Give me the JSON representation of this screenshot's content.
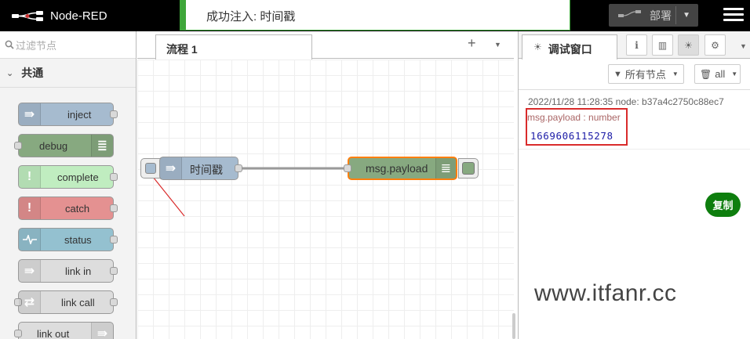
{
  "header": {
    "title": "Node-RED",
    "notification": "成功注入: 时间戳",
    "deploy_label": "部署"
  },
  "palette": {
    "search_placeholder": "过滤节点",
    "category": "共通",
    "nodes": [
      {
        "label": "inject",
        "color": "#a6bbcf"
      },
      {
        "label": "debug",
        "color": "#87a980"
      },
      {
        "label": "complete",
        "color": "#c0edc0"
      },
      {
        "label": "catch",
        "color": "#e49191"
      },
      {
        "label": "status",
        "color": "#94c1d0"
      },
      {
        "label": "link in",
        "color": "#dddddd"
      },
      {
        "label": "link call",
        "color": "#dddddd"
      },
      {
        "label": "link out",
        "color": "#dddddd"
      }
    ]
  },
  "workspace": {
    "tab_label": "流程 1",
    "add_icon": "plus-icon",
    "nodes": {
      "inject_label": "时间戳",
      "debug_label": "msg.payload"
    }
  },
  "sidebar": {
    "tab_label": "调试窗口",
    "filter_label": "所有节点",
    "clear_label": "all",
    "message": {
      "meta": "2022/11/28 11:28:35   node: b37a4c2750c88ec7",
      "topic": "msg.payload : number",
      "value": "1669606115278"
    },
    "copy_label": "复制"
  },
  "watermark": "www.itfanr.cc",
  "colors": {
    "success": "#3ea63a",
    "highlight_border": "#d92b2b",
    "selected_node": "#ff7f0e",
    "copy_button": "#0e7e0e"
  }
}
